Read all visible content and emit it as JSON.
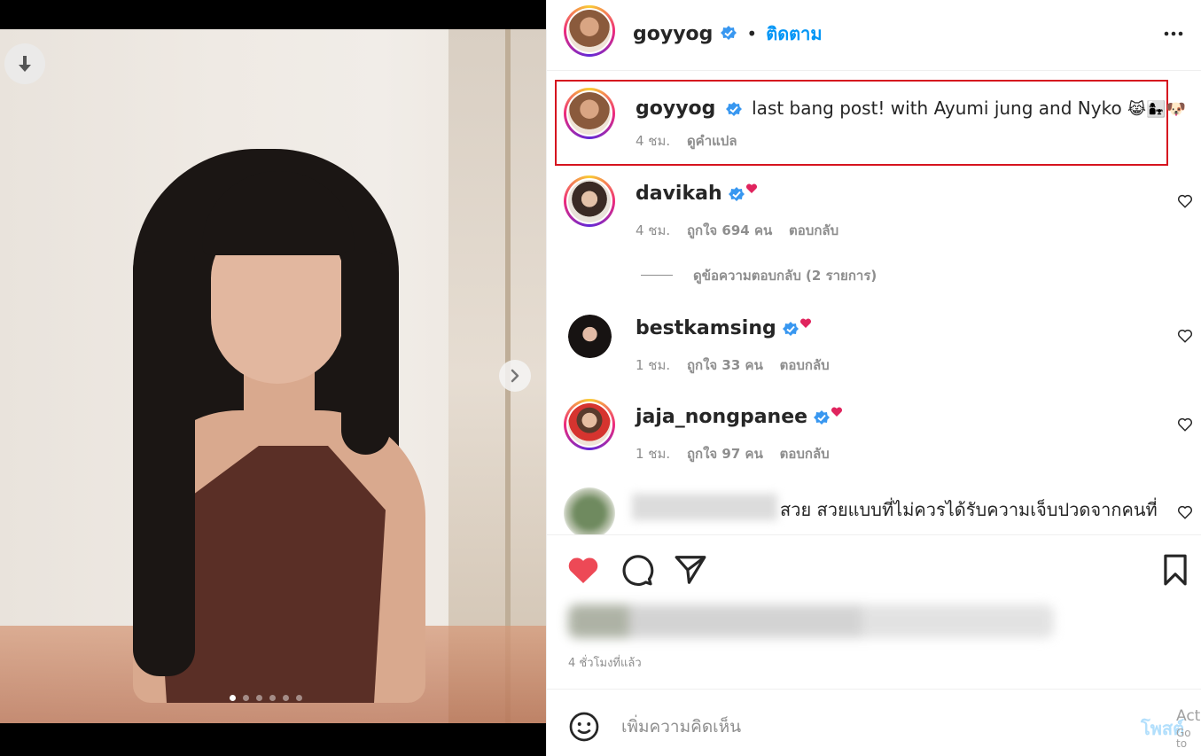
{
  "post": {
    "username": "goyyog",
    "follow_label": "ติดตาม",
    "caption": "last bang post! with Ayumi jung and Nyko",
    "caption_emojis": [
      "😹",
      "👩‍👧",
      "🐶"
    ],
    "caption_time": "4 ชม.",
    "translate_label": "ดูคำแปล",
    "time_ago": "4 ชั่วโมงที่แล้ว",
    "carousel_count": 6,
    "carousel_active": 1
  },
  "comments": [
    {
      "username": "davikah",
      "time": "4 ชม.",
      "likes": "ถูกใจ 694 คน",
      "reply": "ตอบกลับ"
    },
    {
      "username": "bestkamsing",
      "time": "1 ชม.",
      "likes": "ถูกใจ 33 คน",
      "reply": "ตอบกลับ"
    },
    {
      "username": "jaja_nongpanee",
      "time": "1 ชม.",
      "likes": "ถูกใจ 97 คน",
      "reply": "ตอบกลับ"
    },
    {
      "text": "สวย สวยแบบที่ไม่ควรได้รับความเจ็บปวดจากคนที่"
    }
  ],
  "view_replies": "ดูข้อความตอบกลับ (2 รายการ)",
  "composer": {
    "placeholder": "เพิ่มความคิดเห็น",
    "post_label": "โพสต์"
  },
  "watermark": {
    "line1": "Act",
    "line2": "Go to"
  },
  "colors": {
    "accent": "#0095f6",
    "like_red": "#ed4956",
    "highlight": "#d6141f",
    "verified": "#3897f0"
  }
}
